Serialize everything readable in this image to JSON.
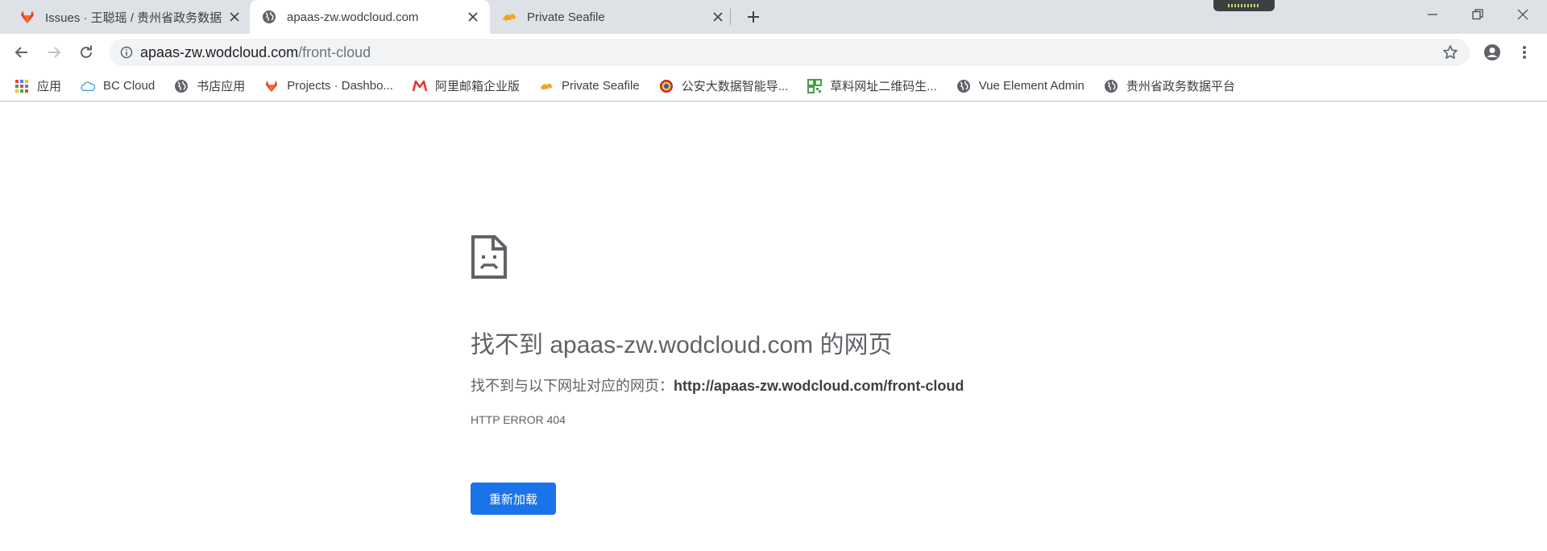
{
  "tabs": [
    {
      "title": "Issues · 王聪瑶 / 贵州省政务数据",
      "icon": "gitlab-icon",
      "active": false
    },
    {
      "title": "apaas-zw.wodcloud.com",
      "icon": "globe-icon",
      "active": true
    },
    {
      "title": "Private Seafile",
      "icon": "seafile-icon",
      "active": false
    }
  ],
  "toolbar": {
    "url_host": "apaas-zw.wodcloud.com",
    "url_path": "/front-cloud"
  },
  "bookmarks": [
    {
      "label": "应用",
      "icon": "apps-grid-icon"
    },
    {
      "label": "BC Cloud",
      "icon": "cloud-icon"
    },
    {
      "label": "书店应用",
      "icon": "globe-icon"
    },
    {
      "label": "Projects · Dashbo...",
      "icon": "gitlab-icon"
    },
    {
      "label": "阿里邮箱企业版",
      "icon": "mail-m-icon"
    },
    {
      "label": "Private Seafile",
      "icon": "seafile-icon"
    },
    {
      "label": "公安大数据智能导...",
      "icon": "police-badge-icon"
    },
    {
      "label": "草料网址二维码生...",
      "icon": "qr-code-icon"
    },
    {
      "label": "Vue Element Admin",
      "icon": "globe-icon"
    },
    {
      "label": "贵州省政务数据平台",
      "icon": "globe-icon"
    }
  ],
  "error": {
    "title": "找不到 apaas-zw.wodcloud.com 的网页",
    "desc_prefix": "找不到与以下网址对应的网页：",
    "desc_url": "http://apaas-zw.wodcloud.com/front-cloud",
    "code": "HTTP ERROR 404",
    "reload_label": "重新加载"
  },
  "colors": {
    "accent": "#1a73e8",
    "tabstrip": "#dee1e6",
    "gitlab": "#e24329",
    "seafile": "#f5a623"
  }
}
